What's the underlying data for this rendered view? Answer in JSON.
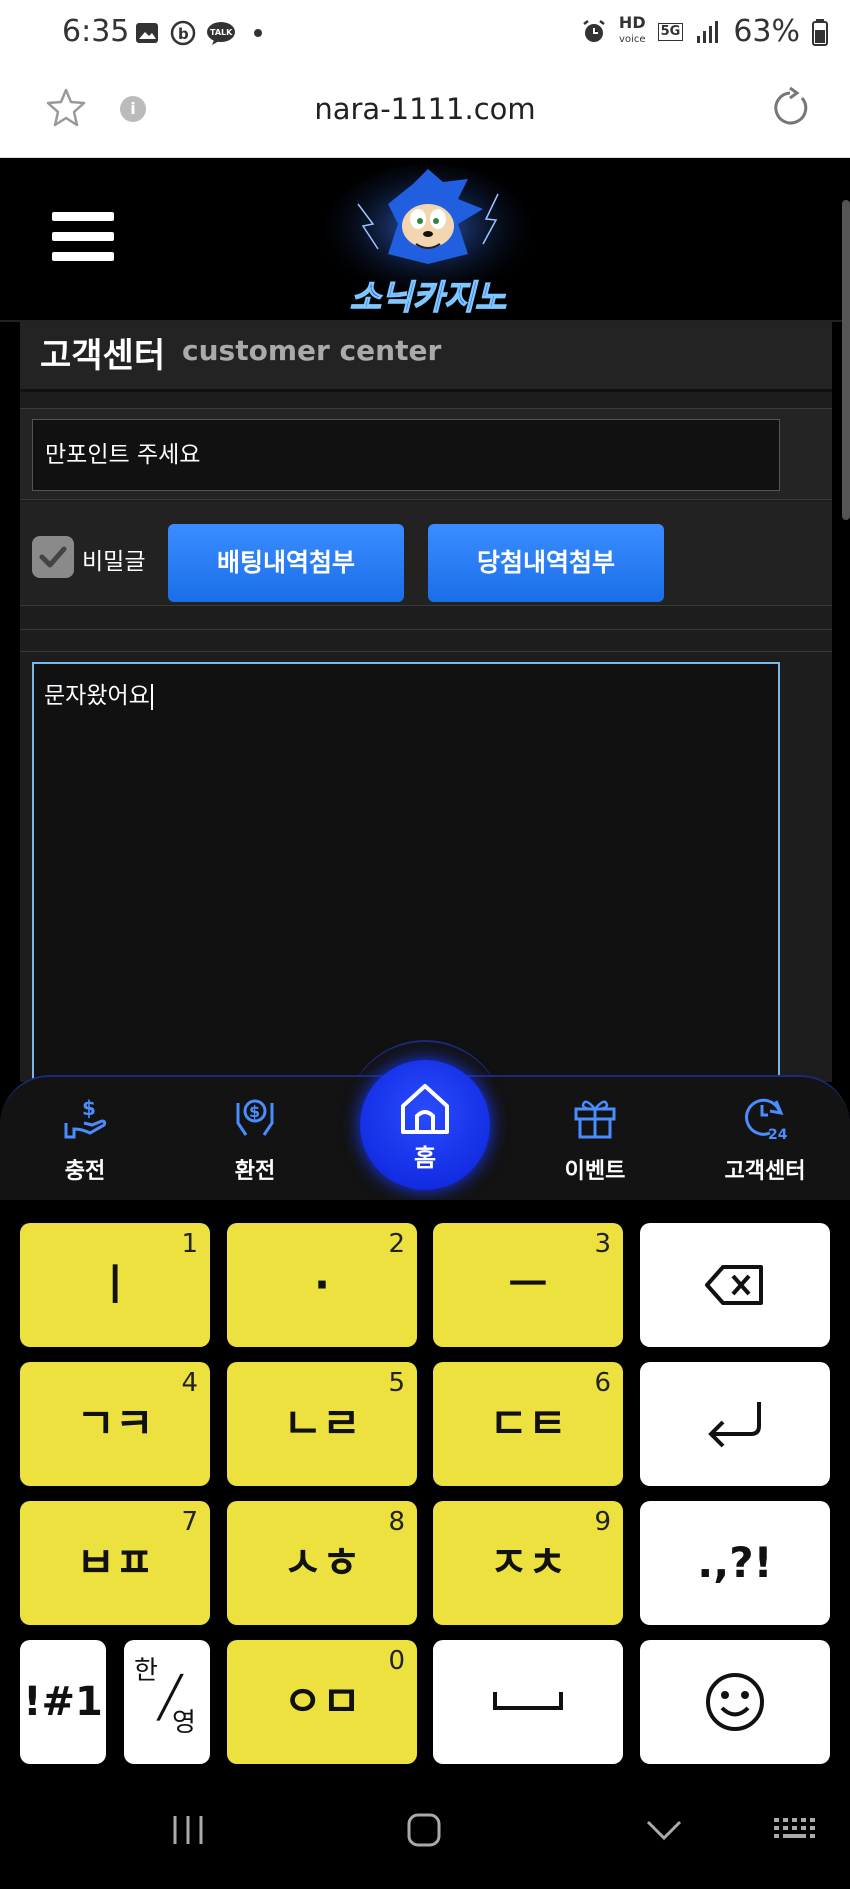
{
  "status_bar": {
    "time": "6:35",
    "battery": "63%",
    "hd_label": "HD",
    "hd_sub": "voice",
    "network": "5G"
  },
  "url_bar": {
    "url": "nara-1111.com"
  },
  "site": {
    "logo_text": "소닉카지노"
  },
  "page": {
    "title_ko": "고객센터",
    "title_en": "customer center",
    "subject_value": "만포인트 주세요",
    "secret_label": "비밀글",
    "btn_bet_attach": "배팅내역첨부",
    "btn_win_attach": "당첨내역첨부",
    "content_value": "문자왔어요"
  },
  "bottom_nav": {
    "charge": "충전",
    "exchange": "환전",
    "home": "홈",
    "event": "이벤트",
    "customer_center": "고객센터"
  },
  "keyboard": {
    "keys": [
      {
        "label": "ㅣ",
        "num": "1"
      },
      {
        "label": "·",
        "num": "2"
      },
      {
        "label": "ㅡ",
        "num": "3"
      },
      {
        "label": "ㄱㅋ",
        "num": "4"
      },
      {
        "label": "ㄴㄹ",
        "num": "5"
      },
      {
        "label": "ㄷㅌ",
        "num": "6"
      },
      {
        "label": "ㅂㅍ",
        "num": "7"
      },
      {
        "label": "ㅅㅎ",
        "num": "8"
      },
      {
        "label": "ㅈㅊ",
        "num": "9"
      },
      {
        "label": "ㅇㅁ",
        "num": "0"
      }
    ],
    "punct": ".,?!",
    "symbols": "!#1",
    "lang_top": "한",
    "lang_bottom": "영"
  },
  "colors": {
    "accent_blue": "#1a6ee8",
    "key_yellow": "#ece13f",
    "home_blue": "#0a21d8"
  }
}
